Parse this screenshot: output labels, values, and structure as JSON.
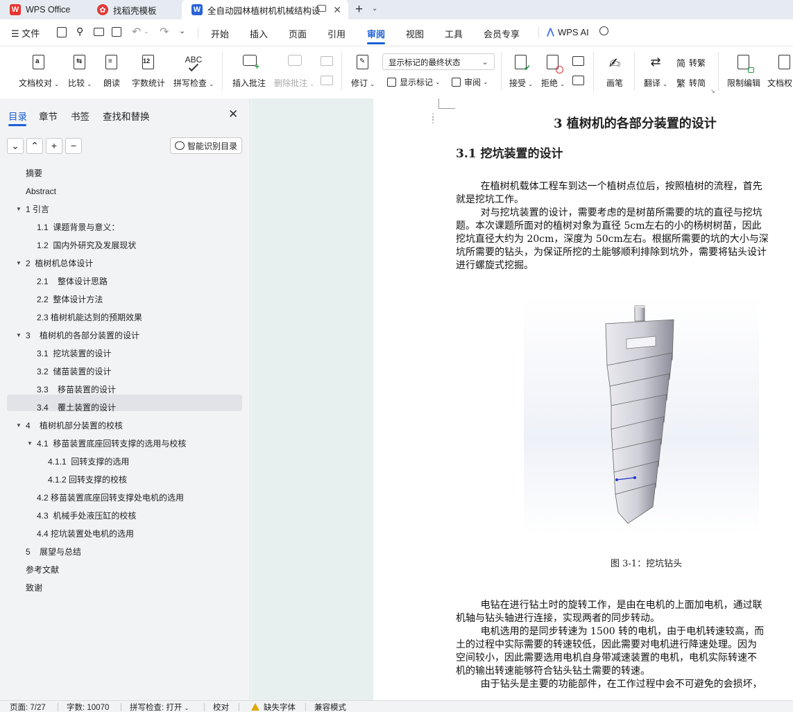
{
  "tabs": [
    {
      "label": "WPS Office"
    },
    {
      "label": "找稻壳模板"
    },
    {
      "label": "全自动园林植树机机械结构设"
    }
  ],
  "menu": {
    "file": "文件",
    "items": [
      "开始",
      "插入",
      "页面",
      "引用",
      "审阅",
      "视图",
      "工具",
      "会员专享"
    ],
    "active": "审阅",
    "wps_ai": "WPS AI"
  },
  "ribbon": {
    "doc_check": "文档校对",
    "compare": "比较",
    "read_aloud": "朗读",
    "word_count": "字数统计",
    "spell_check": "拼写检查",
    "insert_comment": "插入批注",
    "delete_comment": "删除批注",
    "revise": "修订",
    "markup_select": "显示标记的最终状态",
    "show_markup": "显示标记",
    "review": "审阅",
    "accept": "接受",
    "reject": "拒绝",
    "pen": "画笔",
    "translate": "翻译",
    "to_traditional": "转繁",
    "to_simplified": "转简",
    "restrict_edit": "限制编辑",
    "doc_auth": "文档权",
    "word_count_badge": "12",
    "spell_badge": "ABC",
    "trad_char": "简",
    "simp_char": "繁"
  },
  "nav": {
    "tabs": [
      "目录",
      "章节",
      "书签",
      "查找和替换"
    ],
    "smart_toc": "智能识别目录",
    "toc": [
      {
        "label": "摘要",
        "level": 1
      },
      {
        "label": "Abstract",
        "level": 1
      },
      {
        "label": "1 引言",
        "level": 1,
        "expanded": true
      },
      {
        "label": "1.1  课题背景与意义：",
        "level": 2
      },
      {
        "label": "1.2  国内外研究及发展现状",
        "level": 2
      },
      {
        "label": "2  植树机总体设计",
        "level": 1,
        "expanded": true
      },
      {
        "label": "2.1    整体设计思路",
        "level": 2
      },
      {
        "label": "2.2  整体设计方法",
        "level": 2
      },
      {
        "label": "2.3 植树机能达到的预期效果",
        "level": 2
      },
      {
        "label": "3    植树机的各部分装置的设计",
        "level": 1,
        "expanded": true,
        "selected": true
      },
      {
        "label": "3.1  挖坑装置的设计",
        "level": 2
      },
      {
        "label": "3.2  储苗装置的设计",
        "level": 2
      },
      {
        "label": "3.3    移苗装置的设计",
        "level": 2
      },
      {
        "label": "3.4    覆土装置的设计",
        "level": 2
      },
      {
        "label": "4    植树机部分装置的校核",
        "level": 1,
        "expanded": true
      },
      {
        "label": "4.1  移苗装置底座回转支撑的选用与校核",
        "level": 2,
        "expanded": true
      },
      {
        "label": "4.1.1  回转支撑的选用",
        "level": 3
      },
      {
        "label": "4.1.2 回转支撑的校核",
        "level": 3
      },
      {
        "label": "4.2 移苗装置底座回转支撑处电机的选用",
        "level": 2
      },
      {
        "label": "4.3  机械手处液压缸的校核",
        "level": 2
      },
      {
        "label": "4.4 挖坑装置处电机的选用",
        "level": 2
      },
      {
        "label": "5    展望与总结",
        "level": 1
      },
      {
        "label": "参考文献",
        "level": 1
      },
      {
        "label": "致谢",
        "level": 1
      }
    ]
  },
  "document": {
    "chapter_title": "3    植树机的各部分装置的设计",
    "section_title": "3.1  挖坑装置的设计",
    "lines": [
      "        在植树机载体工程车到达一个植树点位后，按照植树的流程，首先",
      "就是挖坑工作。",
      "        对与挖坑装置的设计，需要考虑的是树苗所需要的坑的直径与挖坑",
      "题。本次课题所面对的植树对象为直径 5cm左右的小的杨树树苗，因此",
      "挖坑直径大约为 20cm，深度为 50cm左右。根据所需要的坑的大小与深",
      "坑所需要的钻头，为保证所挖的土能够顺利排除到坑外，需要将钻头设计",
      "进行螺旋式挖掘。"
    ],
    "caption": "图 3-1：挖坑钻头",
    "lines2": [
      "        电钻在进行钻土时的旋转工作，是由在电机的上面加电机，通过联",
      "机轴与钻头轴进行连接，实现两者的同步转动。",
      "        电机选用的是同步转速为 1500 转的电机，由于电机转速较高，而",
      "土的过程中实际需要的转速较低，因此需要对电机进行降速处理。因为",
      "空间较小，因此需要选用电机自身带减速装置的电机，电机实际转速不",
      "机的输出转速能够符合钻头钻土需要的转速。",
      "        由于钻头是主要的功能部件，在工作过程中会不可避免的会损坏，"
    ]
  },
  "status": {
    "page": "页面: 7/27",
    "words": "字数: 10070",
    "spell": "拼写检查: 打开",
    "proof": "校对",
    "missing_font": "缺失字体",
    "compat": "兼容模式"
  },
  "colors": {
    "accent": "#1b5fd6",
    "wps_red": "#e8342f",
    "docer_red": "#e03a3a",
    "doc_blue": "#2b62d9"
  }
}
